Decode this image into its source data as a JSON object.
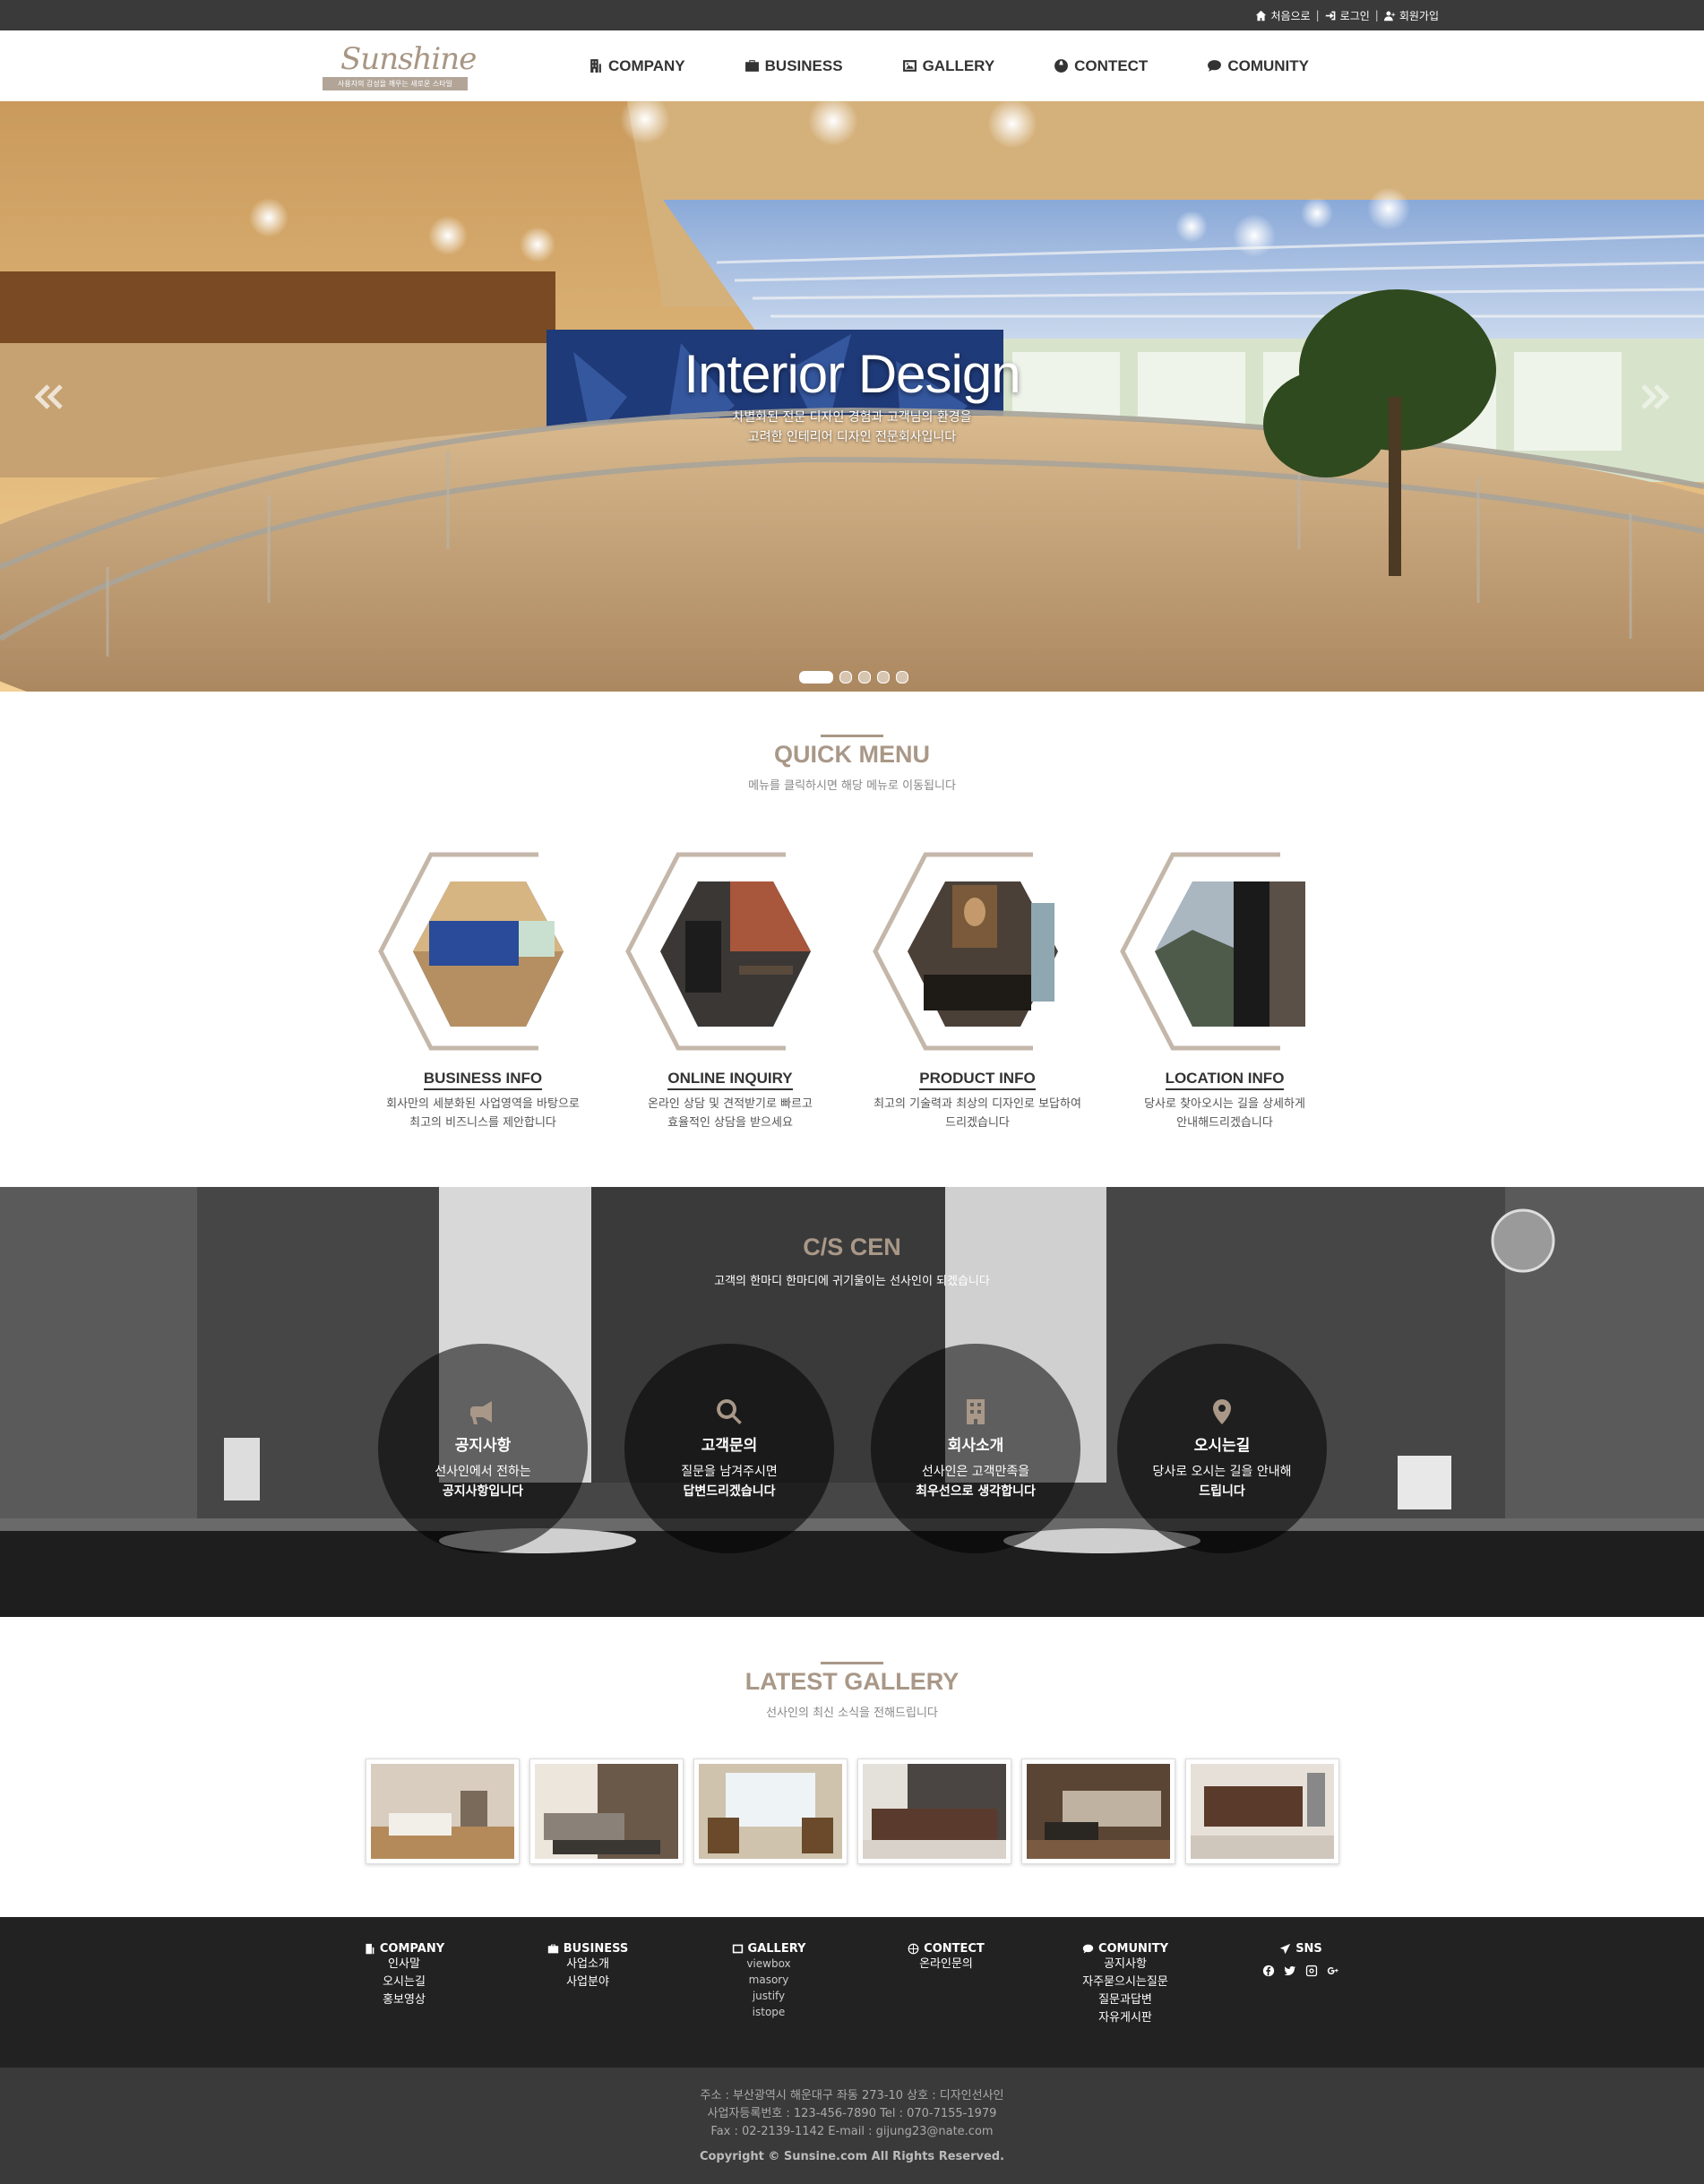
{
  "topbar": {
    "links": [
      {
        "label": "처음으로",
        "icon": "home-icon"
      },
      {
        "label": "로그인",
        "icon": "sign-in-icon"
      },
      {
        "label": "회원가입",
        "icon": "user-plus-icon"
      }
    ],
    "separator": "|"
  },
  "header": {
    "logo_script": "Sunshine",
    "logo_tagline": "사용자의 감성을 깨우는 새로운 스타일",
    "nav": [
      {
        "label": "COMPANY",
        "icon": "building-icon"
      },
      {
        "label": "BUSINESS",
        "icon": "briefcase-icon"
      },
      {
        "label": "GALLERY",
        "icon": "image-icon"
      },
      {
        "label": "CONTECT",
        "icon": "globe-icon"
      },
      {
        "label": "COMUNITY",
        "icon": "comment-icon"
      }
    ]
  },
  "hero": {
    "title": "Interior Design",
    "sub_line1": "차별화된 전문 디자인 경험과 고객님의 환경을",
    "sub_line2": "고려한 인테리어 디자인 전문회사입니다",
    "slide_count": 5,
    "active_slide": 1
  },
  "quick_menu": {
    "title": "QUICK MENU",
    "subtitle": "메뉴를 클릭하시면 해당 메뉴로 이동됩니다",
    "items": [
      {
        "label": "BUSINESS INFO",
        "desc1": "회사만의 세분화된 사업영역을 바탕으로",
        "desc2": "최고의 비즈니스를 제안합니다"
      },
      {
        "label": "ONLINE INQUIRY",
        "desc1": "온라인 상담 및 견적받기로 빠르고",
        "desc2": "효율적인 상담을 받으세요"
      },
      {
        "label": "PRODUCT INFO",
        "desc1": "최고의 기술력과 최상의 디자인로 보답하여",
        "desc2": "드리겠습니다"
      },
      {
        "label": "LOCATION INFO",
        "desc1": "당사로 찾아오시는 길을 상세하게",
        "desc2": "안내해드리겠습니다"
      }
    ]
  },
  "cs": {
    "title": "C/S CEN",
    "subtitle": "고객의 한마디 한마디에 귀기울이는 선사인이 되겠습니다",
    "items": [
      {
        "title": "공지사항",
        "line1": "선사인에서 전하는",
        "line2": "공지사항입니다",
        "icon": "megaphone-icon"
      },
      {
        "title": "고객문의",
        "line1": "질문을 남겨주시면",
        "line2": "답변드리겠습니다",
        "icon": "search-icon"
      },
      {
        "title": "회사소개",
        "line1": "선사인은 고객만족을",
        "line2": "최우선으로 생각합니다",
        "icon": "building-icon"
      },
      {
        "title": "오시는길",
        "line1": "당사로 오시는 길을 안내해",
        "line2": "드립니다",
        "icon": "map-marker-icon"
      }
    ]
  },
  "gallery": {
    "title": "LATEST GALLERY",
    "subtitle": "선사인의 최신 소식을 전해드립니다",
    "count": 6
  },
  "footer": {
    "columns": [
      {
        "head": "COMPANY",
        "icon": "building-icon",
        "links": [
          "인사말",
          "오시는길",
          "홍보영상"
        ]
      },
      {
        "head": "BUSINESS",
        "icon": "briefcase-icon",
        "links": [
          "사업소개",
          "사업분야"
        ]
      },
      {
        "head": "GALLERY",
        "icon": "image-icon",
        "links": [
          "viewbox",
          "masory",
          "justify",
          "istope"
        ]
      },
      {
        "head": "CONTECT",
        "icon": "globe-icon",
        "links": [
          "온라인문의"
        ]
      },
      {
        "head": "COMUNITY",
        "icon": "comment-icon",
        "links": [
          "공지사항",
          "자주묻으시는질문",
          "질문과답변",
          "자유게시판"
        ]
      },
      {
        "head": "SNS",
        "icon": "send-icon",
        "links": []
      }
    ],
    "sns_icons": [
      "facebook-icon",
      "twitter-icon",
      "instagram-icon",
      "google-plus-icon"
    ],
    "address": "주소 : 부산광역시 해운대구 좌동 273-10 상호 : 디자인선사인",
    "bizno": "사업자등록번호 : 123-456-7890 Tel : 070-7155-1979",
    "fax": "Fax : 02-2139-1142 E-mail : gijung23@nate.com",
    "copyright": "Copyright © Sunsine.com All Rights Reserved."
  },
  "colors": {
    "accent": "#a99888",
    "topbar": "#3a3a3a",
    "footer": "#222222",
    "footer_bottom": "#3a3a3a"
  }
}
